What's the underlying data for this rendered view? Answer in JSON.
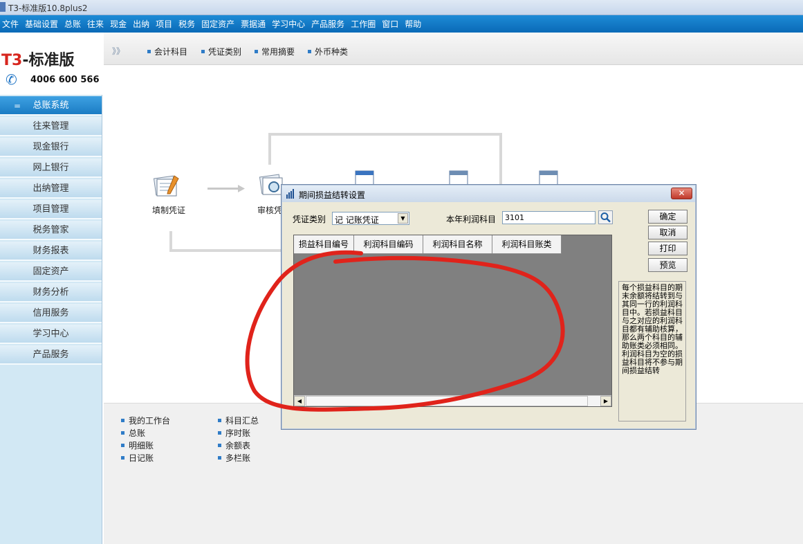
{
  "window": {
    "title": "T3-标准版10.8plus2"
  },
  "menu": [
    "文件",
    "基础设置",
    "总账",
    "往来",
    "现金",
    "出纳",
    "项目",
    "税务",
    "固定资产",
    "票据通",
    "学习中心",
    "产品服务",
    "工作圈",
    "窗口",
    "帮助"
  ],
  "logo": {
    "brand_prefix": "T3",
    "brand_suffix": "-标准版",
    "phone": "4006 600 566"
  },
  "sidebar": {
    "items": [
      {
        "label": "总账系统",
        "active": true
      },
      {
        "label": "往来管理"
      },
      {
        "label": "现金银行"
      },
      {
        "label": "网上银行"
      },
      {
        "label": "出纳管理"
      },
      {
        "label": "项目管理"
      },
      {
        "label": "税务管家"
      },
      {
        "label": "财务报表"
      },
      {
        "label": "固定资产"
      },
      {
        "label": "财务分析"
      },
      {
        "label": "信用服务"
      },
      {
        "label": "学习中心"
      },
      {
        "label": "产品服务"
      }
    ]
  },
  "toolbar": {
    "collapse": "》》",
    "items": [
      "会计科目",
      "凭证类别",
      "常用摘要",
      "外币种类"
    ]
  },
  "flow": {
    "fill_voucher": "填制凭证",
    "audit_voucher": "审核凭"
  },
  "quick_links": {
    "col1": [
      "我的工作台",
      "总账",
      "明细账",
      "日记账"
    ],
    "col2": [
      "科目汇总",
      "序时账",
      "余额表",
      "多栏账"
    ]
  },
  "dialog": {
    "title": "期间损益结转设置",
    "close": "✕",
    "voucher_type_label": "凭证类别",
    "voucher_type_value": "记    记账凭证",
    "profit_account_label": "本年利润科目",
    "profit_account_value": "3101",
    "buttons": {
      "ok": "确定",
      "cancel": "取消",
      "print": "打印",
      "preview": "预览"
    },
    "grid_columns": [
      "损益科目编号",
      "利润科目编码",
      "利润科目名称",
      "利润科目账类"
    ],
    "info_text": "每个损益科目的期末余额将结转到与其同一行的利润科目中。若损益科目与之对应的利润科目都有辅助核算，那么两个科目的辅助账类必须相同。利润科目为空的损益科目将不参与期间损益结转",
    "annotation_color": "#e0231b"
  }
}
